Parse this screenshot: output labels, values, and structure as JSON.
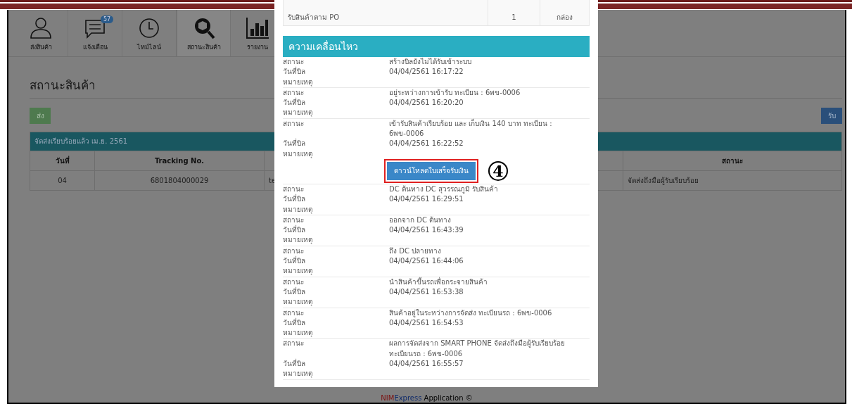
{
  "tabs": [
    {
      "label": "ส่งสินค้า",
      "selected": false
    },
    {
      "label": "แจ้งเตือน",
      "badge": "57",
      "selected": false
    },
    {
      "label": "ไทม์ไลน์",
      "selected": false
    },
    {
      "label": "สถานะสินค้า",
      "selected": true
    },
    {
      "label": "รายงาน",
      "selected": false
    }
  ],
  "page_title": "สถานะสินค้า",
  "send_button": "ส่ง",
  "receive_button": "รับ",
  "table": {
    "caption": "จัดส่งเรียบร้อยแล้ว เม.ย. 2561",
    "columns": [
      {
        "label": "วันที่"
      },
      {
        "label": "Tracking No."
      },
      {
        "hidden": true
      },
      {
        "label": "สถานะ"
      }
    ],
    "rows": [
      [
        "04",
        "6801804000029",
        "te",
        "จัดส่งถึงมือผู้รับเรียบร้อย"
      ]
    ]
  },
  "footer": {
    "brand_first": "NIM",
    "brand_second": "Express",
    "text": " Application ©"
  },
  "modal": {
    "items_row": {
      "description": "รับสินค้าตาม PO",
      "quantity": "1",
      "unit": "กล่อง"
    },
    "section_title": "ความเคลื่อนไหว",
    "events": [
      {
        "fields": [
          {
            "label": "สถานะ",
            "value": "สร้างบิลยังไม่ได้รับเข้าระบบ"
          },
          {
            "label": "วันที่บิล",
            "value": "04/04/2561 16:17:22"
          },
          {
            "label": "หมายเหตุ"
          }
        ]
      },
      {
        "fields": [
          {
            "label": "สถานะ",
            "value": "อยู่ระหว่างการเข้ารับ ทะเบียน : 6พข-0006"
          },
          {
            "label": "วันที่บิล",
            "value": "04/04/2561 16:20:20"
          },
          {
            "label": "หมายเหตุ"
          }
        ]
      },
      {
        "fields": [
          {
            "label": "สถานะ",
            "value": "เข้ารับสินค้าเรียบร้อย และ เก็บเงิน 140 บาท ทะเบียน : 6พข-0006"
          },
          {
            "label": "วันที่บิล",
            "value": "04/04/2561 16:22:52"
          },
          {
            "label": "หมายเหตุ"
          }
        ],
        "button": "ดาวน์โหลดใบเสร็จรับเงิน",
        "annotation": "4"
      },
      {
        "fields": [
          {
            "label": "สถานะ",
            "value": "DC ต้นทาง DC สุวรรณภูมิ รับสินค้า"
          },
          {
            "label": "วันที่บิล",
            "value": "04/04/2561 16:29:51"
          },
          {
            "label": "หมายเหตุ"
          }
        ]
      },
      {
        "fields": [
          {
            "label": "สถานะ",
            "value": "ออกจาก DC ต้นทาง"
          },
          {
            "label": "วันที่บิล",
            "value": "04/04/2561 16:43:39"
          },
          {
            "label": "หมายเหตุ"
          }
        ]
      },
      {
        "fields": [
          {
            "label": "สถานะ",
            "value": "ถึง DC ปลายทาง"
          },
          {
            "label": "วันที่บิล",
            "value": "04/04/2561 16:44:06"
          },
          {
            "label": "หมายเหตุ"
          }
        ]
      },
      {
        "fields": [
          {
            "label": "สถานะ",
            "value": "นำสินค้าขึ้นรถเพื่อกระจายสินค้า"
          },
          {
            "label": "วันที่บิล",
            "value": "04/04/2561 16:53:38"
          },
          {
            "label": "หมายเหตุ"
          }
        ]
      },
      {
        "fields": [
          {
            "label": "สถานะ",
            "value": "สินค้าอยู่ในระหว่างการจัดส่ง ทะเบียนรถ : 6พข-0006"
          },
          {
            "label": "วันที่บิล",
            "value": "04/04/2561 16:54:53"
          },
          {
            "label": "หมายเหตุ"
          }
        ]
      },
      {
        "fields": [
          {
            "label": "สถานะ",
            "value": "ผลการจัดส่งจาก SMART PHONE จัดส่งถึงมือผู้รับเรียบร้อย ทะเบียนรถ : 6พข-0006"
          },
          {
            "label": "วันที่บิล",
            "value": "04/04/2561 16:55:57"
          },
          {
            "label": "หมายเหตุ"
          }
        ]
      }
    ]
  }
}
